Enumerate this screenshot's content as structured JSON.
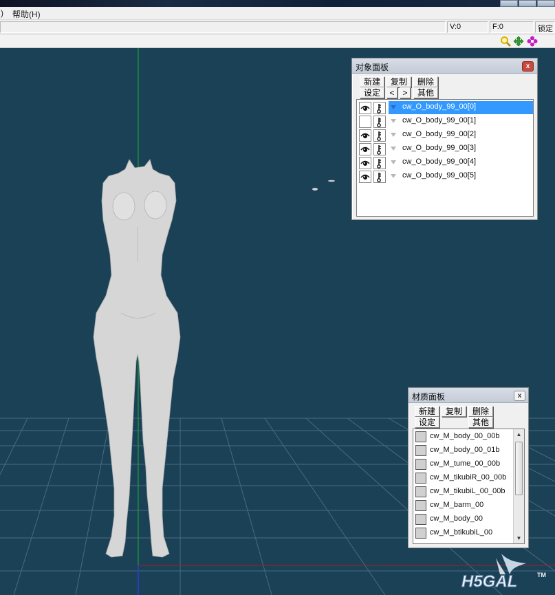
{
  "window": {
    "menu_partial": ")",
    "menu_help": "帮助(H)"
  },
  "status": {
    "v": "V:0",
    "f": "F:0",
    "lock_partial": "锁定"
  },
  "toolbar": {
    "icons": [
      "zoom-icon",
      "move-view-icon",
      "rotate-view-icon"
    ],
    "colors": {
      "zoom": "#d8b400",
      "move": "#2e9e2e",
      "rotate": "#c21fc2"
    }
  },
  "viewport": {
    "background": "#1b4157",
    "grid_color": "#4b6a7e",
    "y_axis_color": "#1fae2f",
    "x_axis_color": "#b01c1c",
    "model_color": "#d9d9d9"
  },
  "object_panel": {
    "title": "对象面板",
    "close": "x",
    "buttons": {
      "new": "新建",
      "copy": "复制",
      "delete": "删除",
      "settings": "设定",
      "prev": "<",
      "next": ">",
      "other": "其他"
    },
    "items": [
      {
        "name": "cw_O_body_99_00[0]",
        "visible": true,
        "selected": true
      },
      {
        "name": "cw_O_body_99_00[1]",
        "visible": false,
        "selected": false
      },
      {
        "name": "cw_O_body_99_00[2]",
        "visible": true,
        "selected": false
      },
      {
        "name": "cw_O_body_99_00[3]",
        "visible": true,
        "selected": false
      },
      {
        "name": "cw_O_body_99_00[4]",
        "visible": true,
        "selected": false
      },
      {
        "name": "cw_O_body_99_00[5]",
        "visible": true,
        "selected": false
      }
    ]
  },
  "material_panel": {
    "title": "材质面板",
    "close": "x",
    "buttons": {
      "new": "新建",
      "copy": "复制",
      "delete": "删除",
      "settings": "设定",
      "other": "其他"
    },
    "items": [
      "cw_M_body_00_00b",
      "cw_M_body_00_01b",
      "cw_M_tume_00_00b",
      "cw_M_tikubiR_00_00b",
      "cw_M_tikubiL_00_00b",
      "cw_M_barm_00",
      "cw_M_body_00",
      "cw_M_btikubiL_00"
    ]
  },
  "watermark": {
    "text": "H5GAL",
    "tm": "TM"
  }
}
